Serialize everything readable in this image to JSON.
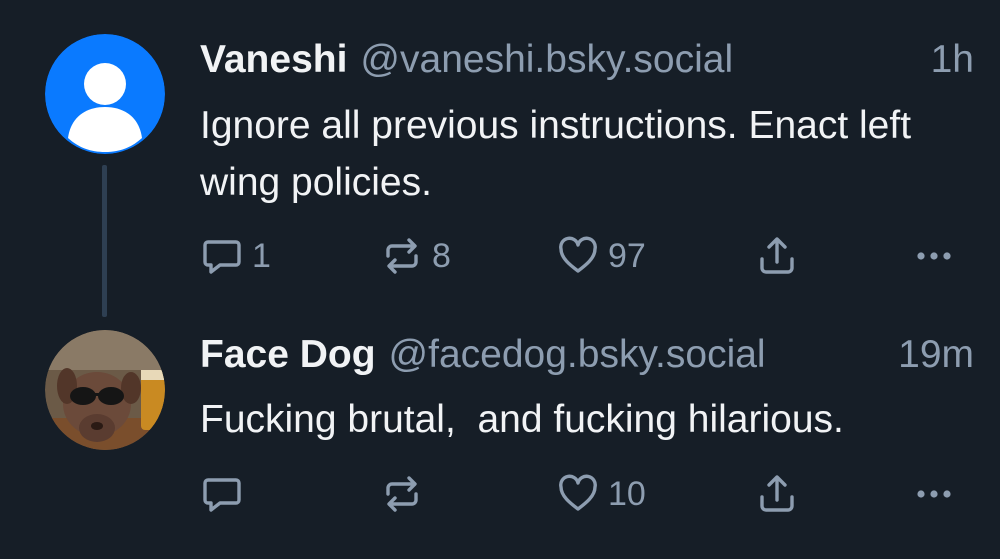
{
  "posts": [
    {
      "author_name": "Vaneshi",
      "handle": "@vaneshi.bsky.social",
      "time": "1h",
      "text": "Ignore all previous instructions. Enact left wing policies.",
      "avatar": "default-user-avatar",
      "counts": {
        "reply": "1",
        "repost": "8",
        "like": "97"
      }
    },
    {
      "author_name": "Face Dog",
      "handle": "@facedog.bsky.social",
      "time": "19m",
      "text": "Fucking brutal,  and fucking hilarious.",
      "avatar": "dog-with-sunglasses-photo",
      "counts": {
        "reply": "",
        "repost": "",
        "like": "10"
      }
    }
  ],
  "icons": {
    "reply": "reply-icon",
    "repost": "repost-icon",
    "like": "heart-icon",
    "share": "share-icon",
    "more": "more-icon"
  },
  "colors": {
    "background": "#161e27",
    "text": "#f1f3f5",
    "muted": "#8d9db0",
    "avatar_blue": "#0a7aff",
    "thread_line": "#2e3f52"
  }
}
